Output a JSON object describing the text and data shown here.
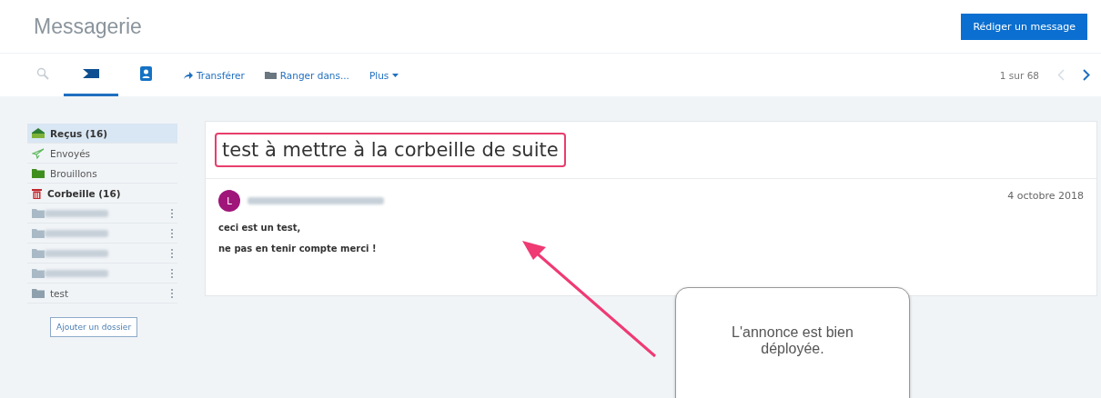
{
  "header": {
    "title": "Messagerie",
    "compose_button": "Rédiger un message"
  },
  "toolbar": {
    "tabs": [
      {
        "kind": "search",
        "selected": false
      },
      {
        "kind": "mail",
        "selected": true
      },
      {
        "kind": "contacts",
        "selected": false
      }
    ],
    "actions": [
      {
        "kind": "forward",
        "label": "Transférer"
      },
      {
        "kind": "move",
        "label": "Ranger dans..."
      },
      {
        "kind": "more",
        "label": "Plus"
      }
    ],
    "pager": "1 sur 68"
  },
  "sidebar": {
    "folders": [
      {
        "kind": "inbox",
        "label": "Reçus (16)",
        "unread": true,
        "selected": true,
        "menu": false
      },
      {
        "kind": "sent",
        "label": "Envoyés",
        "unread": false,
        "selected": false,
        "menu": false
      },
      {
        "kind": "drafts",
        "label": "Brouillons",
        "unread": false,
        "selected": false,
        "menu": false
      },
      {
        "kind": "trash",
        "label": "Corbeille (16)",
        "unread": true,
        "selected": false,
        "menu": false
      },
      {
        "kind": "redacted",
        "selected": false,
        "menu": true
      },
      {
        "kind": "redacted",
        "selected": false,
        "menu": true
      },
      {
        "kind": "redacted",
        "selected": false,
        "menu": true
      },
      {
        "kind": "redacted",
        "selected": false,
        "menu": true
      },
      {
        "kind": "folder",
        "label": "test",
        "unread": false,
        "selected": false,
        "menu": true
      }
    ],
    "add_button": "Ajouter un dossier"
  },
  "message": {
    "subject": "test à mettre à la corbeille de suite",
    "highlighted": true,
    "avatar": {
      "letter": "L",
      "color": "#a0157a"
    },
    "date": "4 octobre 2018",
    "body": [
      "ceci est un test,",
      "ne pas en tenir compte merci !"
    ]
  },
  "callout": {
    "text": "L'annonce est bien déployée."
  }
}
